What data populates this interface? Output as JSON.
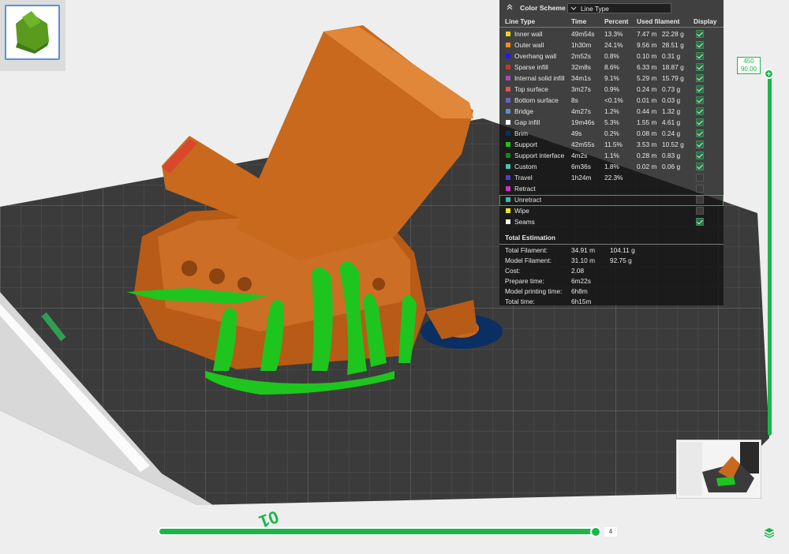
{
  "color_scheme": {
    "title": "Color Scheme",
    "selected": "Line Type",
    "headers": [
      "Line Type",
      "Time",
      "Percent",
      "Used filament",
      "Display"
    ],
    "rows": [
      {
        "type": "Inner wall",
        "color": "#f1d21c",
        "time": "49m54s",
        "percent": "13.3%",
        "length": "7.47 m",
        "weight": "22.28 g",
        "display": true
      },
      {
        "type": "Outer wall",
        "color": "#ff8a17",
        "time": "1h30m",
        "percent": "24.1%",
        "length": "9.56 m",
        "weight": "28.51 g",
        "display": true
      },
      {
        "type": "Overhang wall",
        "color": "#1c1cff",
        "time": "2m52s",
        "percent": "0.8%",
        "length": "0.10 m",
        "weight": "0.31 g",
        "display": true
      },
      {
        "type": "Sparse infill",
        "color": "#c0392b",
        "time": "32m8s",
        "percent": "8.6%",
        "length": "6.33 m",
        "weight": "18.87 g",
        "display": true
      },
      {
        "type": "Internal solid infill",
        "color": "#a24cc4",
        "time": "34m1s",
        "percent": "9.1%",
        "length": "5.29 m",
        "weight": "15.79 g",
        "display": true
      },
      {
        "type": "Top surface",
        "color": "#e8504b",
        "time": "3m27s",
        "percent": "0.9%",
        "length": "0.24 m",
        "weight": "0.73 g",
        "display": true
      },
      {
        "type": "Bottom surface",
        "color": "#6a63c8",
        "time": "8s",
        "percent": "<0.1%",
        "length": "0.01 m",
        "weight": "0.03 g",
        "display": true
      },
      {
        "type": "Bridge",
        "color": "#5f8ec8",
        "time": "4m27s",
        "percent": "1.2%",
        "length": "0.44 m",
        "weight": "1.32 g",
        "display": true
      },
      {
        "type": "Gap infill",
        "color": "#ffffff",
        "time": "19m46s",
        "percent": "5.3%",
        "length": "1.55 m",
        "weight": "4.61 g",
        "display": true
      },
      {
        "type": "Brim",
        "color": "#0b2e63",
        "time": "49s",
        "percent": "0.2%",
        "length": "0.08 m",
        "weight": "0.24 g",
        "display": true
      },
      {
        "type": "Support",
        "color": "#1ec51e",
        "time": "42m55s",
        "percent": "11.5%",
        "length": "3.53 m",
        "weight": "10.52 g",
        "display": true
      },
      {
        "type": "Support interface",
        "color": "#118a1a",
        "time": "4m2s",
        "percent": "1.1%",
        "length": "0.28 m",
        "weight": "0.83 g",
        "display": true
      },
      {
        "type": "Custom",
        "color": "#47c6a8",
        "time": "6m36s",
        "percent": "1.8%",
        "length": "0.02 m",
        "weight": "0.06 g",
        "display": true
      },
      {
        "type": "Travel",
        "color": "#4a3fcf",
        "time": "1h24m",
        "percent": "22.3%",
        "length": "",
        "weight": "",
        "display": false
      },
      {
        "type": "Retract",
        "color": "#d22fd2",
        "time": "",
        "percent": "",
        "length": "",
        "weight": "",
        "display": false
      },
      {
        "type": "Unretract",
        "color": "#3fb5b5",
        "time": "",
        "percent": "",
        "length": "",
        "weight": "",
        "display": false
      },
      {
        "type": "Wipe",
        "color": "#f7e01c",
        "time": "",
        "percent": "",
        "length": "",
        "weight": "",
        "display": false
      },
      {
        "type": "Seams",
        "color": "#f2f2f2",
        "time": "",
        "percent": "",
        "length": "",
        "weight": "",
        "display": true
      }
    ]
  },
  "total_estimation": {
    "title": "Total Estimation",
    "items": [
      {
        "label": "Total Filament:",
        "v1": "34.91 m",
        "v2": "104.11 g"
      },
      {
        "label": "Model Filament:",
        "v1": "31.10 m",
        "v2": "92.75 g"
      },
      {
        "label": "Cost:",
        "v1": "2.08",
        "v2": ""
      },
      {
        "label": "Prepare time:",
        "v1": "6m22s",
        "v2": ""
      },
      {
        "label": "Model printing time:",
        "v1": "6h8m",
        "v2": ""
      },
      {
        "label": "Total time:",
        "v1": "6h15m",
        "v2": ""
      }
    ]
  },
  "layer_slider": {
    "top_layer": "450",
    "top_height": "90.00",
    "move_value": "4"
  },
  "colors": {
    "accent": "#1bb54a",
    "model": "#c8691e",
    "support": "#1ec51e",
    "plate": "#3a3a3a"
  }
}
